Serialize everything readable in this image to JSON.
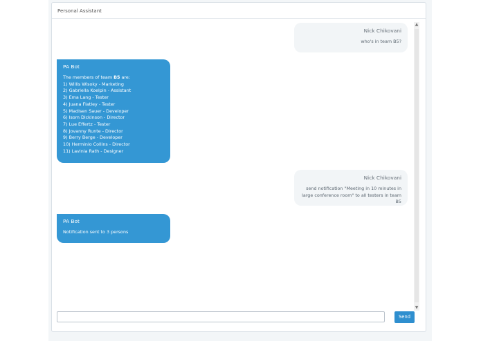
{
  "panel": {
    "title": "Personal Assistant"
  },
  "messages": [
    {
      "role": "user",
      "sender": "Nick Chikovani",
      "text": "who's in team B5?"
    },
    {
      "role": "bot",
      "sender": "PA Bot",
      "intro": "The members of team ",
      "team": "B5",
      "intro_end": " are:",
      "members": [
        "1) Willis Wisoky - Marketing",
        "2) Gabriella Koelpin - Assistant",
        "3) Ema Lang - Tester",
        "4) Juana Flatley - Tester",
        "5) Madisen Sauer - Developer",
        "6) Isom Dickinson - Director",
        "7) Lue Effertz - Tester",
        "8) Jovanny Runte - Director",
        "9) Berry Berge - Developer",
        "10) Herminio Collins - Director",
        "11) Lavinia Rath - Designer"
      ]
    },
    {
      "role": "user",
      "sender": "Nick Chikovani",
      "text": "send notification \"Meeting in 10 minutes in large conference room\" to all testers in team B5"
    },
    {
      "role": "bot",
      "sender": "PA Bot",
      "text": "Notification sent to 3 persons"
    }
  ],
  "composer": {
    "value": "",
    "placeholder": "",
    "send_label": "Send"
  },
  "scrollbar": {
    "up_icon": "▲",
    "down_icon": "▼"
  },
  "colors": {
    "bot_bubble": "#3497d4",
    "user_bubble": "#f2f5f7",
    "send_button": "#2f8fcf"
  }
}
